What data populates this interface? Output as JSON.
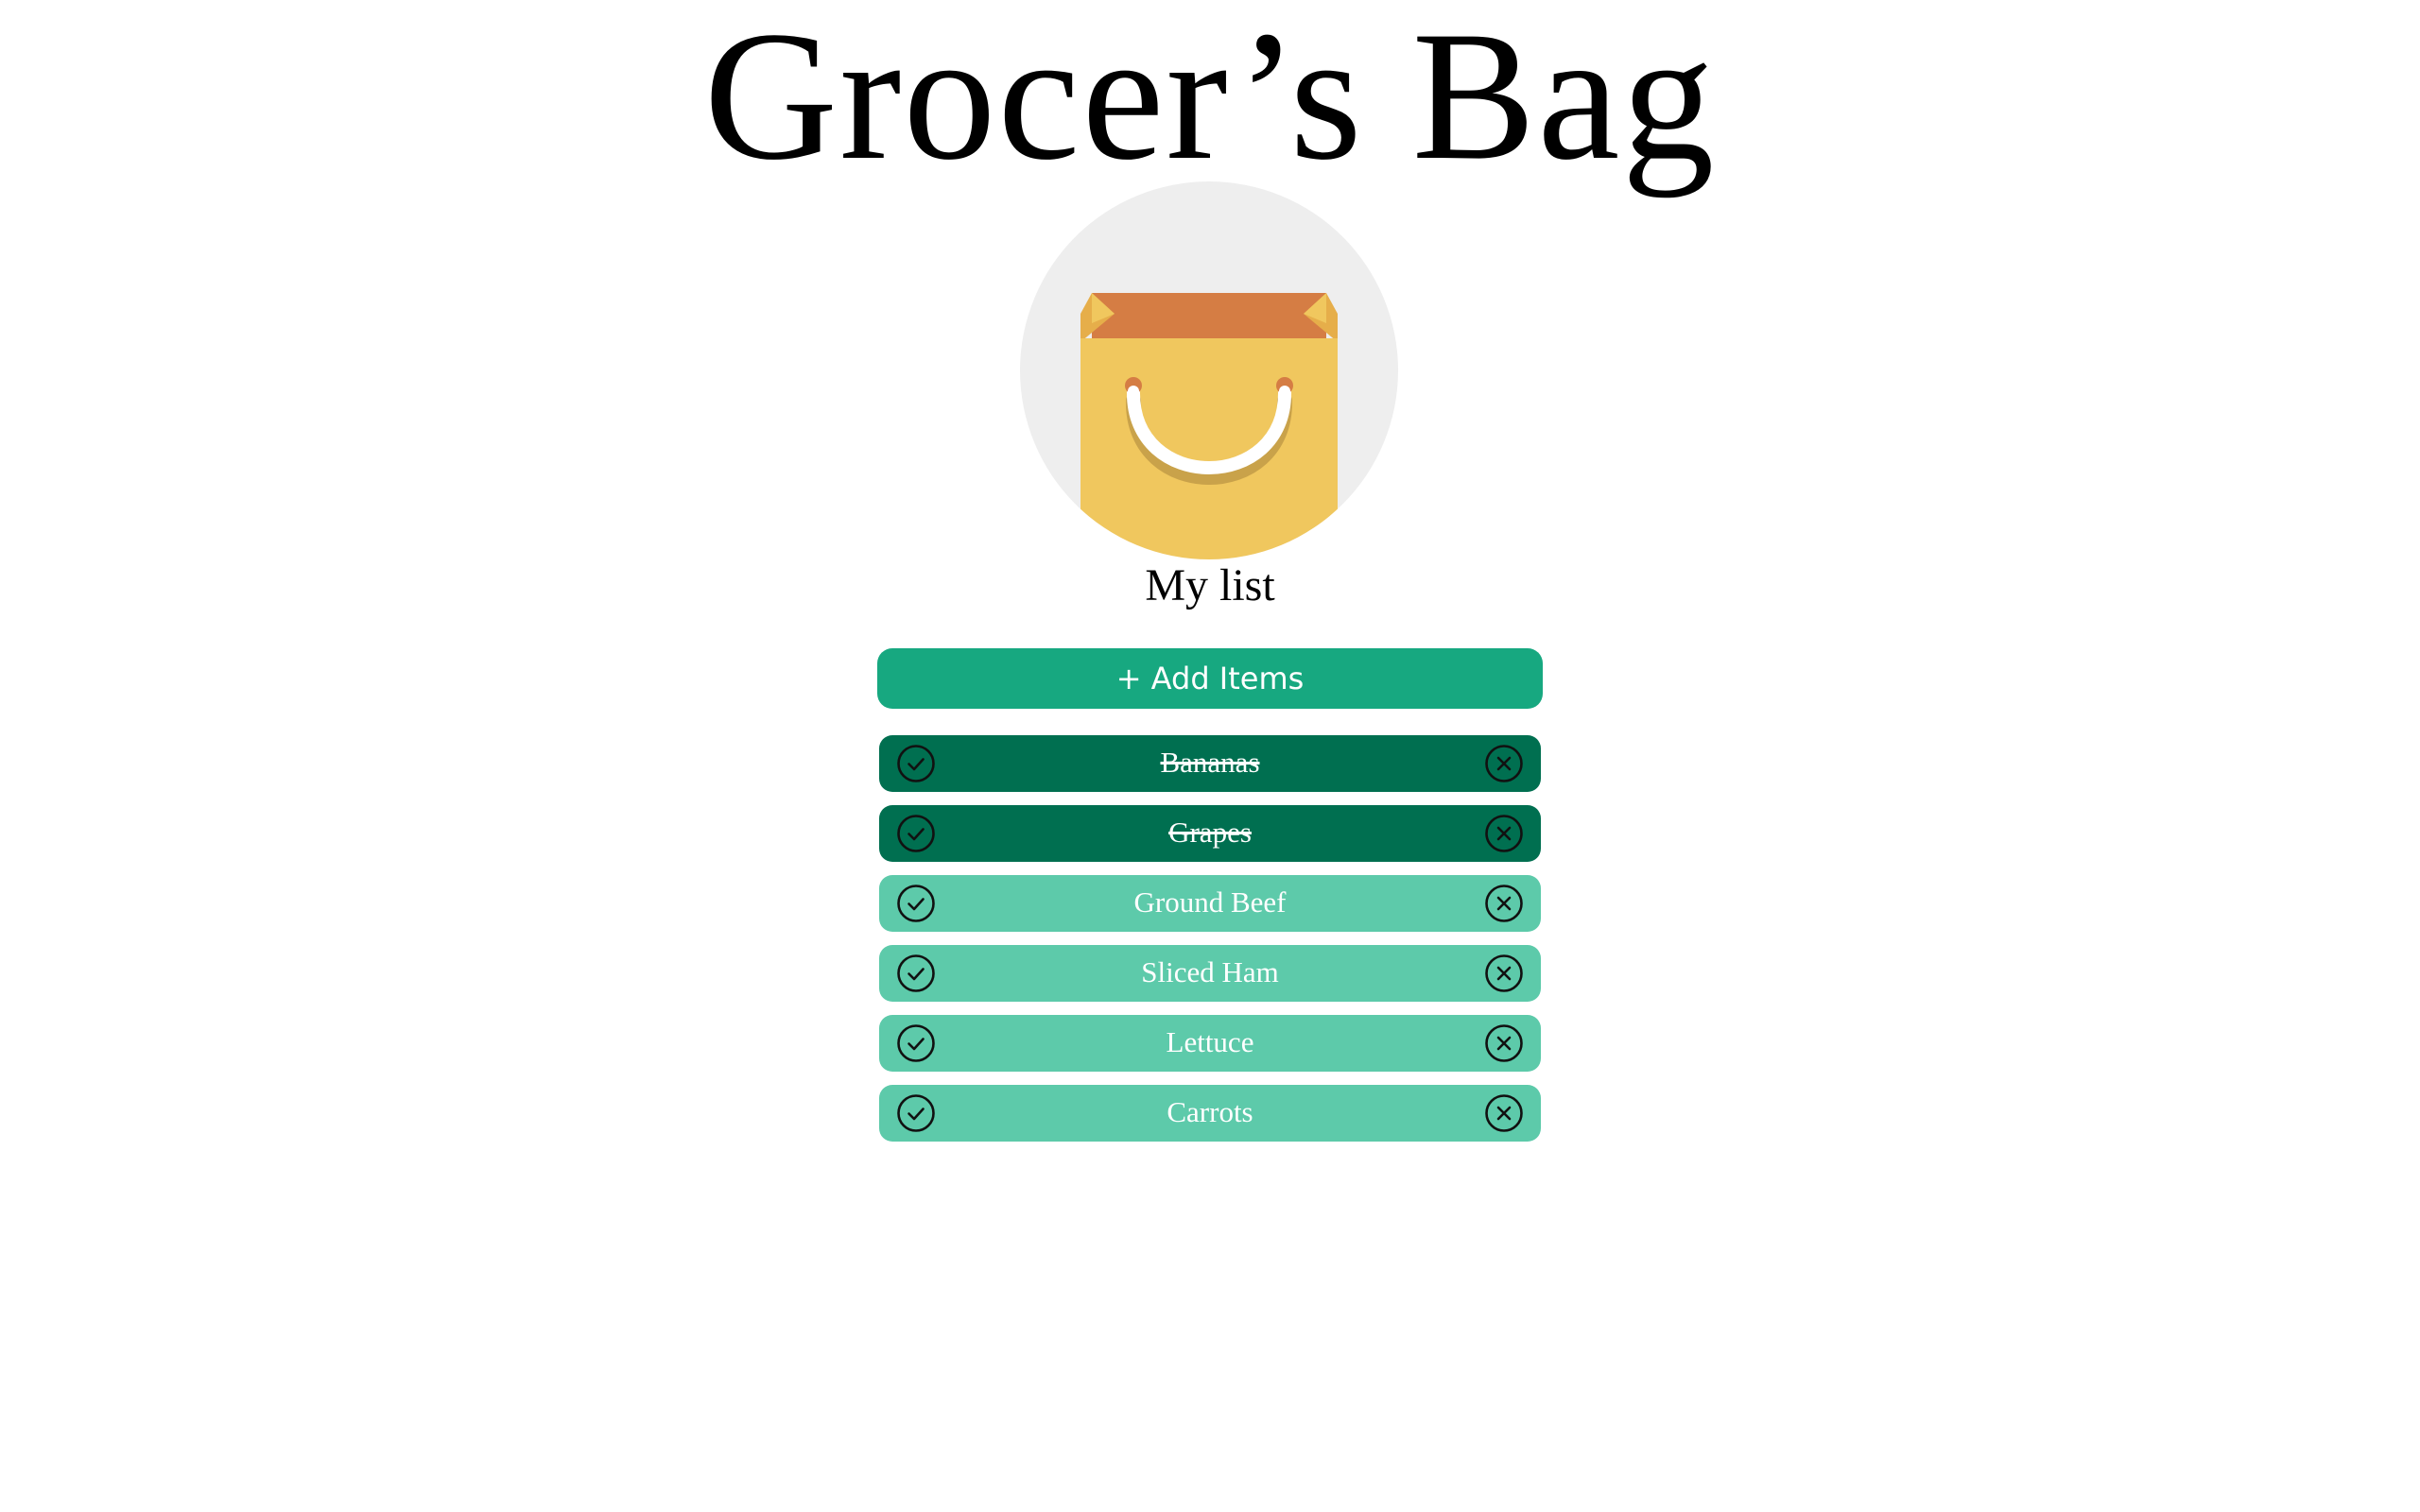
{
  "header": {
    "title": "Grocer’s Bag"
  },
  "icons": {
    "logo": "shopping-bag-icon",
    "check": "check-circle-icon",
    "remove": "close-circle-icon"
  },
  "list": {
    "title": "My list",
    "add_button_label": "+ Add Items",
    "items": [
      {
        "label": "Bananas",
        "done": true
      },
      {
        "label": "Grapes",
        "done": true
      },
      {
        "label": "Ground Beef",
        "done": false
      },
      {
        "label": "Sliced Ham",
        "done": false
      },
      {
        "label": "Lettuce",
        "done": false
      },
      {
        "label": "Carrots",
        "done": false
      }
    ]
  },
  "colors": {
    "add_button": "#17a880",
    "item_pending": "#5dcaaa",
    "item_done": "#006f50",
    "bag_body": "#f0c75e",
    "bag_inner": "#d57d44",
    "avatar_bg": "#eeeeee"
  }
}
